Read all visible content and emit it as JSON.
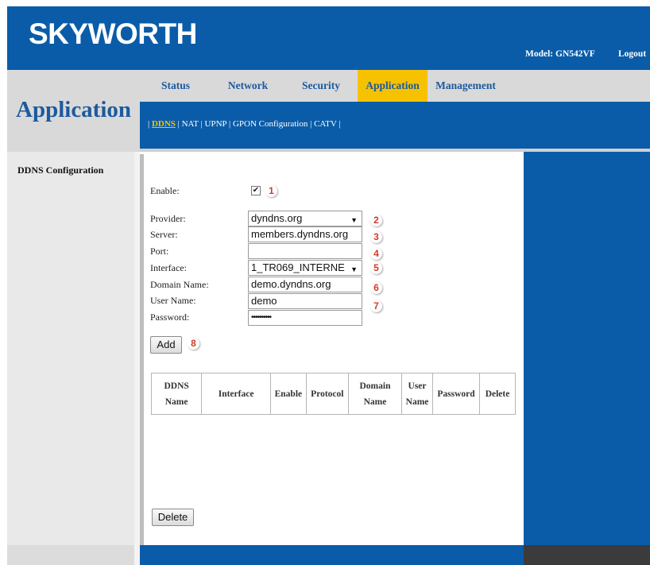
{
  "header": {
    "logo": "SKYWORTH",
    "model": "Model: GN542VF",
    "logout": "Logout"
  },
  "tabs": [
    {
      "label": "Status",
      "active": false
    },
    {
      "label": "Network",
      "active": false
    },
    {
      "label": "Security",
      "active": false
    },
    {
      "label": "Application",
      "active": true
    },
    {
      "label": "Management",
      "active": false
    }
  ],
  "page_title": "Application",
  "subnav": {
    "links": [
      "DDNS",
      "NAT",
      "UPNP",
      "GPON Configuration",
      "CATV"
    ],
    "current": "DDNS"
  },
  "sidebar": {
    "items": [
      "DDNS Configuration"
    ]
  },
  "form": {
    "enable": {
      "label": "Enable:",
      "checked": true,
      "mark": "✔",
      "badge": "1"
    },
    "provider": {
      "label": "Provider:",
      "value": "dyndns.org",
      "badge": "2"
    },
    "server": {
      "label": "Server:",
      "value": "members.dyndns.org",
      "badge": "3"
    },
    "port": {
      "label": "Port:",
      "value": "",
      "badge": "4"
    },
    "interface": {
      "label": "Interface:",
      "value": "1_TR069_INTERNE",
      "badge": "5"
    },
    "domain_name": {
      "label": "Domain Name:",
      "value": "demo.dyndns.org",
      "badge": "6"
    },
    "user_name": {
      "label": "User Name:",
      "value": "demo",
      "badge": "7"
    },
    "password": {
      "label": "Password:",
      "value": "••••••••••"
    },
    "add_button": {
      "label": "Add",
      "badge": "8"
    }
  },
  "table": {
    "headers": [
      {
        "line1": "DDNS",
        "line2": "Name"
      },
      {
        "line1": "Interface",
        "line2": ""
      },
      {
        "line1": "Enable",
        "line2": ""
      },
      {
        "line1": "Protocol",
        "line2": ""
      },
      {
        "line1": "Domain",
        "line2": "Name"
      },
      {
        "line1": "User",
        "line2": "Name"
      },
      {
        "line1": "Password",
        "line2": ""
      },
      {
        "line1": "Delete",
        "line2": ""
      }
    ]
  },
  "delete_button": {
    "label": "Delete"
  },
  "colors": {
    "brand_blue": "#0a5ca8",
    "active_tab": "#f6c200",
    "badge_red": "#d23a2a"
  }
}
